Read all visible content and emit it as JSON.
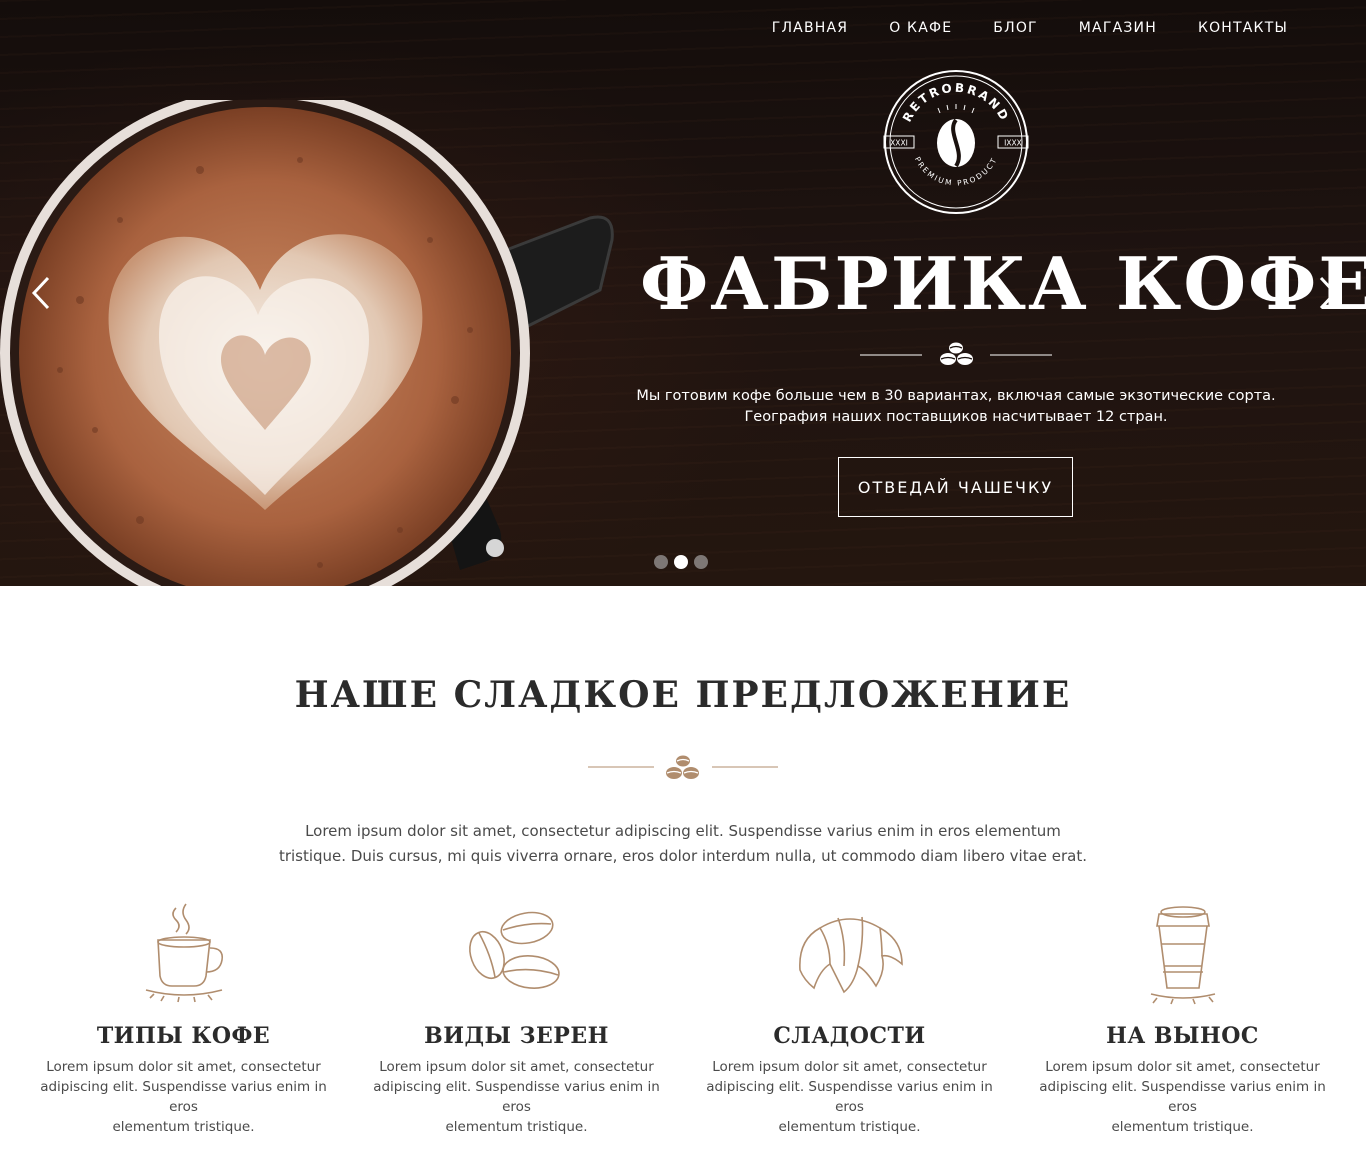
{
  "nav": {
    "items": [
      "ГЛАВНАЯ",
      "О КАФЕ",
      "БЛОГ",
      "МАГАЗИН",
      "КОНТАКТЫ"
    ]
  },
  "logo": {
    "brand": "RETROBRAND",
    "left_mark": "XXXI",
    "right_mark": "IXXX",
    "tagline": "PREMIUM PRODUCT"
  },
  "hero": {
    "title": "ФАБРИКА КОФЕ",
    "text_line1": "Мы готовим кофе больше чем в 30 вариантах, включая самые экзотические сорта.",
    "text_line2": "География наших поставщиков насчитывает 12 стран.",
    "button": "ОТВЕДАЙ ЧАШЕЧКУ",
    "slides_total": 3,
    "active_slide": 2
  },
  "offer": {
    "title": "НАШЕ СЛАДКОЕ ПРЕДЛОЖЕНИЕ",
    "text_line1": "Lorem ipsum dolor sit amet, consectetur adipiscing elit. Suspendisse varius enim in eros elementum",
    "text_line2": "tristique. Duis cursus, mi quis viverra ornare, eros dolor interdum nulla, ut commodo diam libero vitae erat."
  },
  "features": [
    {
      "icon": "coffee-cup-icon",
      "title": "ТИПЫ КОФЕ",
      "l1": "Lorem ipsum dolor sit amet, consectetur",
      "l2": "adipiscing elit. Suspendisse varius enim in eros",
      "l3": "elementum tristique."
    },
    {
      "icon": "coffee-beans-icon",
      "title": "ВИДЫ ЗЕРЕН",
      "l1": "Lorem ipsum dolor sit amet, consectetur",
      "l2": "adipiscing elit. Suspendisse varius enim in eros",
      "l3": "elementum tristique."
    },
    {
      "icon": "croissant-icon",
      "title": "СЛАДОСТИ",
      "l1": "Lorem ipsum dolor sit amet, consectetur",
      "l2": "adipiscing elit. Suspendisse varius enim in eros",
      "l3": "elementum tristique."
    },
    {
      "icon": "takeaway-cup-icon",
      "title": "НА ВЫНОС",
      "l1": "Lorem ipsum dolor sit amet, consectetur",
      "l2": "adipiscing elit. Suspendisse varius enim in eros",
      "l3": "elementum tristique."
    }
  ],
  "colors": {
    "accent": "#b08d6e",
    "heading": "#2b2b2b",
    "body_text": "#4a4a4a",
    "hero_bg": "#1a110e"
  }
}
